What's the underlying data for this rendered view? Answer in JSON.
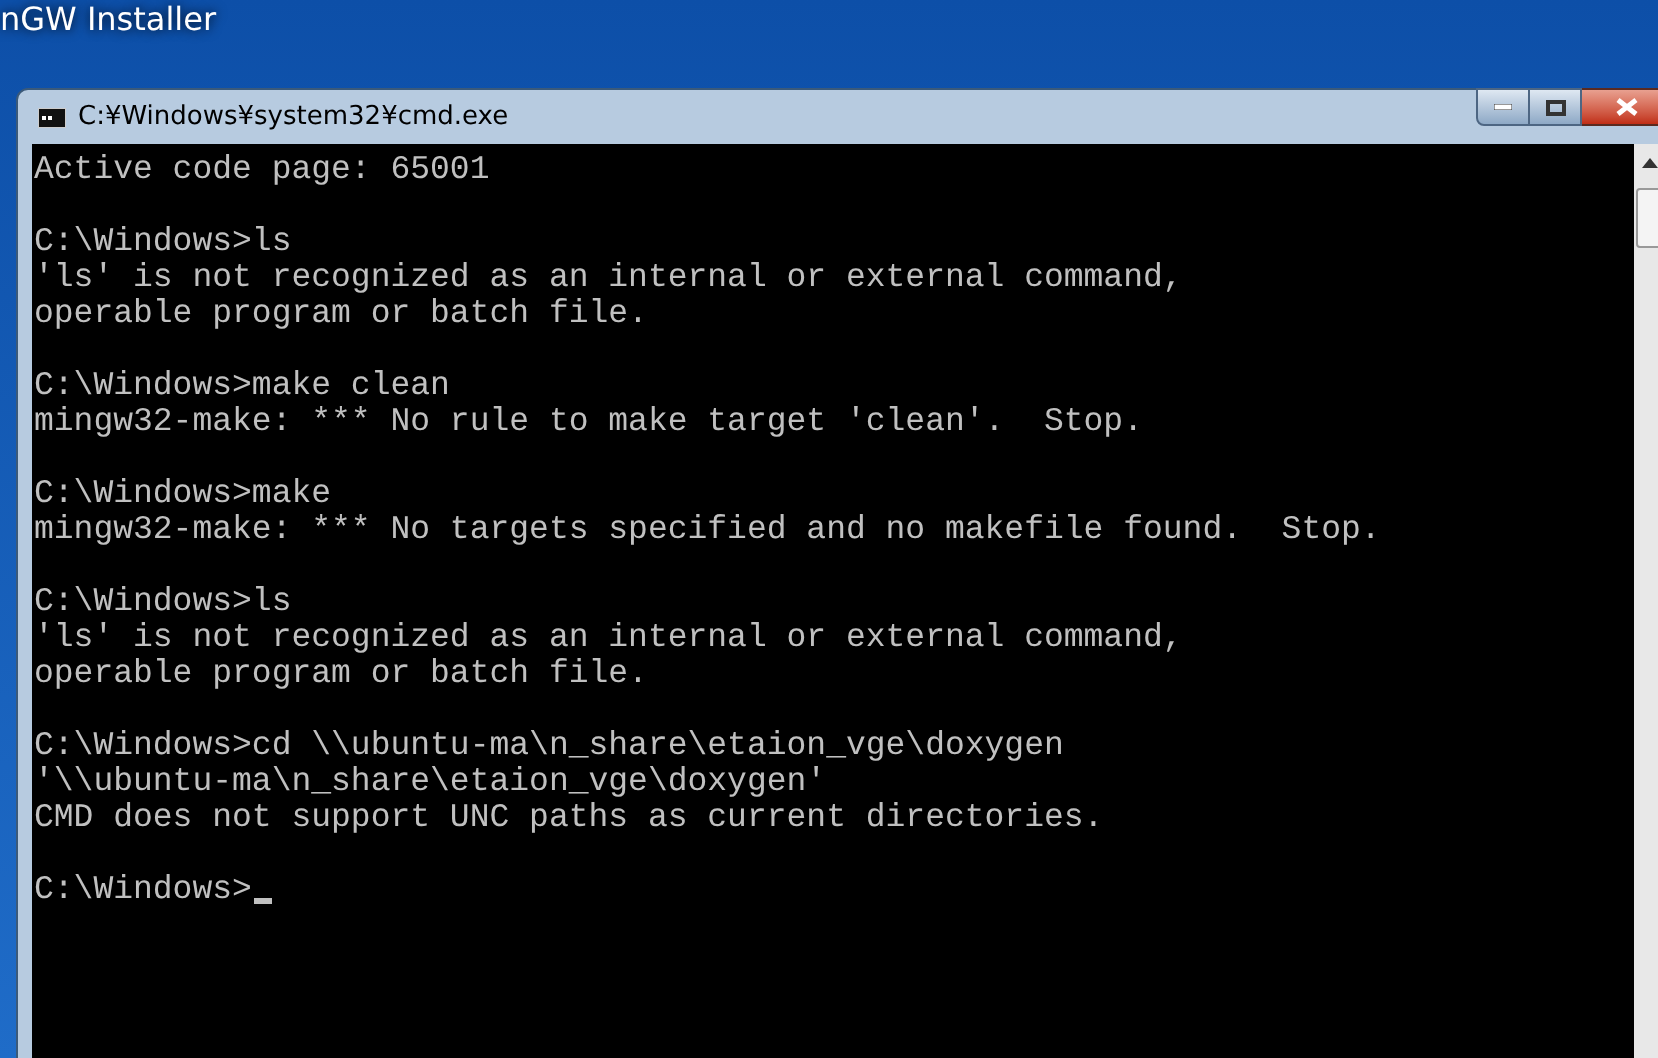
{
  "background_window": {
    "title": "nGW Installer"
  },
  "window": {
    "title": "C:¥Windows¥system32¥cmd.exe"
  },
  "console": {
    "blocks": [
      [
        "Active code page: 65001"
      ],
      [
        "C:\\Windows>ls",
        "'ls' is not recognized as an internal or external command,",
        "operable program or batch file."
      ],
      [
        "C:\\Windows>make clean",
        "mingw32-make: *** No rule to make target 'clean'.  Stop."
      ],
      [
        "C:\\Windows>make",
        "mingw32-make: *** No targets specified and no makefile found.  Stop."
      ],
      [
        "C:\\Windows>ls",
        "'ls' is not recognized as an internal or external command,",
        "operable program or batch file."
      ],
      [
        "C:\\Windows>cd \\\\ubuntu-ma\\n_share\\etaion_vge\\doxygen",
        "'\\\\ubuntu-ma\\n_share\\etaion_vge\\doxygen'",
        "CMD does not support UNC paths as current directories."
      ]
    ],
    "prompt": "C:\\Windows>"
  }
}
